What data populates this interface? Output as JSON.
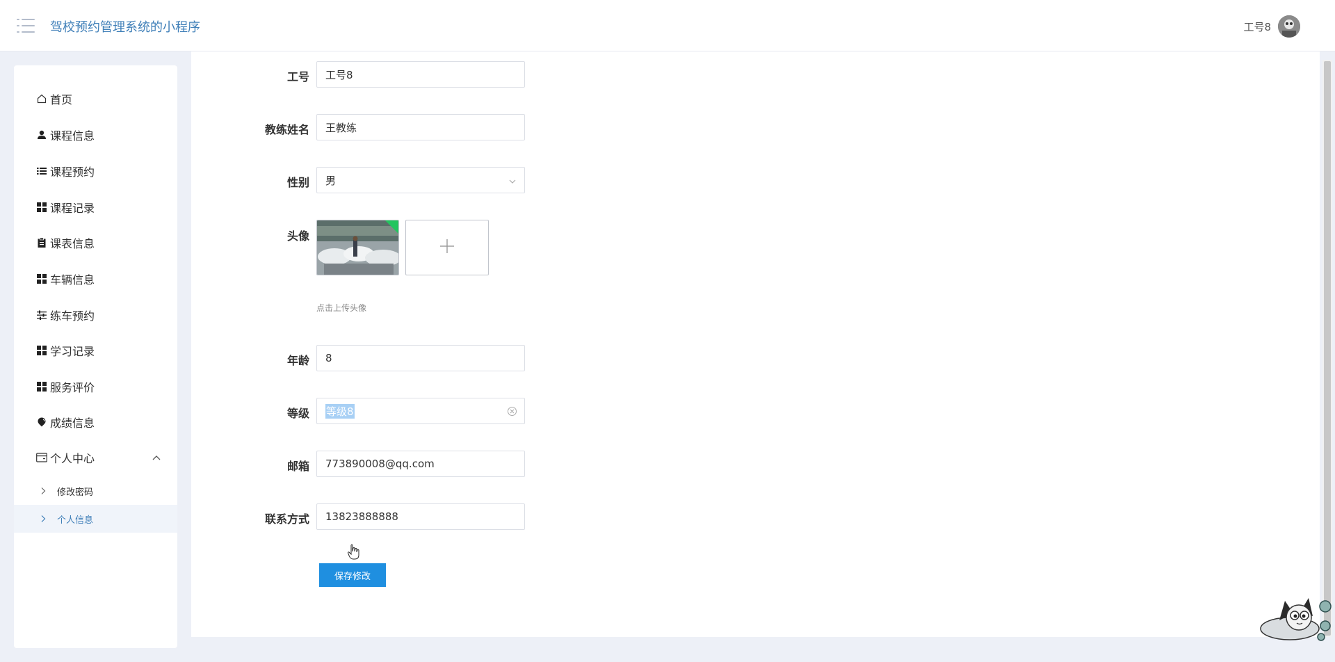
{
  "header": {
    "title": "驾校预约管理系统的小程序",
    "user_name": "工号8",
    "menu_icon": "menu-list-icon"
  },
  "sidebar": {
    "items": [
      {
        "label": "首页",
        "icon": "home-icon"
      },
      {
        "label": "课程信息",
        "icon": "user-icon"
      },
      {
        "label": "课程预约",
        "icon": "list-icon"
      },
      {
        "label": "课程记录",
        "icon": "grid-icon"
      },
      {
        "label": "课表信息",
        "icon": "clipboard-icon"
      },
      {
        "label": "车辆信息",
        "icon": "grid-icon"
      },
      {
        "label": "练车预约",
        "icon": "sliders-icon"
      },
      {
        "label": "学习记录",
        "icon": "grid-icon"
      },
      {
        "label": "服务评价",
        "icon": "grid-icon"
      },
      {
        "label": "成绩信息",
        "icon": "pin-icon"
      }
    ],
    "personal_center": {
      "label": "个人中心",
      "icon": "card-icon",
      "expanded": true,
      "children": [
        {
          "label": "修改密码",
          "active": false
        },
        {
          "label": "个人信息",
          "active": true
        }
      ]
    }
  },
  "form": {
    "job_number": {
      "label": "工号",
      "value": "工号8"
    },
    "coach_name": {
      "label": "教练姓名",
      "value": "王教练"
    },
    "gender": {
      "label": "性别",
      "value": "男"
    },
    "avatar": {
      "label": "头像",
      "hint": "点击上传头像"
    },
    "age": {
      "label": "年龄",
      "value": "8"
    },
    "level": {
      "label": "等级",
      "value": "等级8"
    },
    "email": {
      "label": "邮箱",
      "value": "773890008@qq.com"
    },
    "contact": {
      "label": "联系方式",
      "value": "13823888888"
    },
    "save_label": "保存修改"
  },
  "colors": {
    "accent": "#1f8fe0",
    "title": "#3f7fb8",
    "background": "#edf0f7"
  }
}
